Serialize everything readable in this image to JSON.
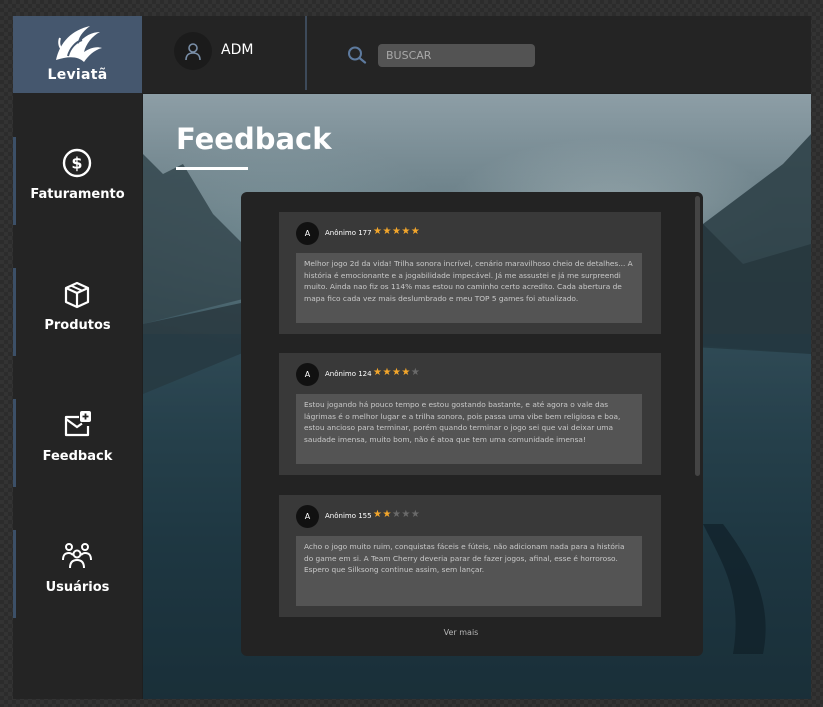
{
  "brand": {
    "name": "Leviatã"
  },
  "user": {
    "name": "ADM"
  },
  "search": {
    "placeholder": "BUSCAR"
  },
  "sidebar": {
    "items": [
      {
        "label": "Faturamento",
        "icon": "dollar-circle-icon"
      },
      {
        "label": "Produtos",
        "icon": "box-icon"
      },
      {
        "label": "Feedback",
        "icon": "mail-plus-icon"
      },
      {
        "label": "Usuários",
        "icon": "users-icon"
      }
    ]
  },
  "page": {
    "title": "Feedback"
  },
  "feedbacks": [
    {
      "avatar": "A",
      "name": "Anônimo 177",
      "rating": 5,
      "text": "Melhor jogo 2d da vida! Trilha sonora incrível, cenário maravilhoso cheio de detalhes... A história é emocionante e a jogabilidade impecável. Já me assustei e já me surpreendi muito. Ainda nao fiz os 114% mas estou no caminho certo acredito. Cada abertura de mapa fico cada vez mais deslumbrado e meu TOP 5 games foi atualizado."
    },
    {
      "avatar": "A",
      "name": "Anônimo 124",
      "rating": 4,
      "text": "Estou jogando há pouco tempo e estou gostando bastante, e até agora o vale das lágrimas é o melhor lugar e a trilha sonora, pois passa uma vibe bem religiosa e boa, estou ancioso para terminar, porém quando terminar o jogo sei que vai deixar uma saudade imensa, muito bom, não é atoa que tem uma comunidade imensa!"
    },
    {
      "avatar": "A",
      "name": "Anônimo 155",
      "rating": 2,
      "text": "Acho o jogo muito ruim, conquistas fáceis e fúteis, não adicionam nada para a história do game em si. A Team Cherry deveria parar de fazer jogos, afinal, esse é horroroso. Espero que Silksong continue assim, sem lançar."
    }
  ],
  "see_more": "Ver mais",
  "colors": {
    "accent": "#45576e",
    "star": "#f3a62b",
    "star_off": "#6a6a6a"
  }
}
